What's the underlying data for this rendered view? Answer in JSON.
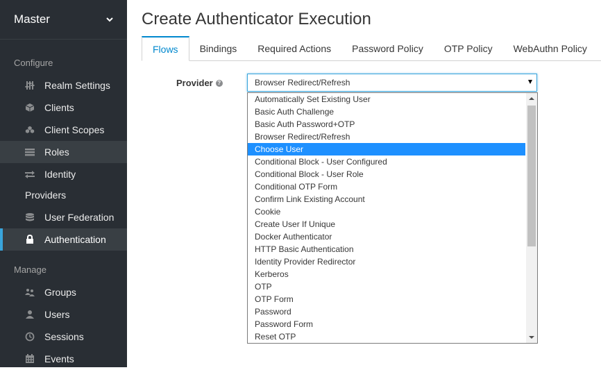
{
  "sidebar": {
    "realm": "Master",
    "configure_title": "Configure",
    "configure_items": [
      {
        "label": "Realm Settings",
        "icon": "sliders-icon"
      },
      {
        "label": "Clients",
        "icon": "cube-icon"
      },
      {
        "label": "Client Scopes",
        "icon": "cubes-icon"
      },
      {
        "label": "Roles",
        "icon": "list-icon"
      },
      {
        "label": "Identity",
        "icon": "exchange-icon"
      },
      {
        "label": "Providers",
        "icon": ""
      },
      {
        "label": "User Federation",
        "icon": "database-icon"
      },
      {
        "label": "Authentication",
        "icon": "lock-icon"
      }
    ],
    "manage_title": "Manage",
    "manage_items": [
      {
        "label": "Groups",
        "icon": "users-icon"
      },
      {
        "label": "Users",
        "icon": "user-icon"
      },
      {
        "label": "Sessions",
        "icon": "clock-icon"
      },
      {
        "label": "Events",
        "icon": "calendar-icon"
      }
    ]
  },
  "main": {
    "title": "Create Authenticator Execution",
    "tabs": [
      {
        "label": "Flows",
        "active": true
      },
      {
        "label": "Bindings"
      },
      {
        "label": "Required Actions"
      },
      {
        "label": "Password Policy"
      },
      {
        "label": "OTP Policy"
      },
      {
        "label": "WebAuthn Policy"
      }
    ],
    "provider_label": "Provider",
    "help_glyph": "?",
    "selected_value": "Browser Redirect/Refresh",
    "options": [
      "Automatically Set Existing User",
      "Basic Auth Challenge",
      "Basic Auth Password+OTP",
      "Browser Redirect/Refresh",
      "Choose User",
      "Conditional Block - User Configured",
      "Conditional Block - User Role",
      "Conditional OTP Form",
      "Confirm Link Existing Account",
      "Cookie",
      "Create User If Unique",
      "Docker Authenticator",
      "HTTP Basic Authentication",
      "Identity Provider Redirector",
      "Kerberos",
      "OTP",
      "OTP Form",
      "Password",
      "Password Form",
      "Reset OTP"
    ],
    "highlighted_option": "Choose User"
  },
  "colors": {
    "sidebar_bg": "#292e34",
    "active_accent": "#39a5dc",
    "tab_active": "#0088ce",
    "option_highlight": "#1e90ff"
  }
}
